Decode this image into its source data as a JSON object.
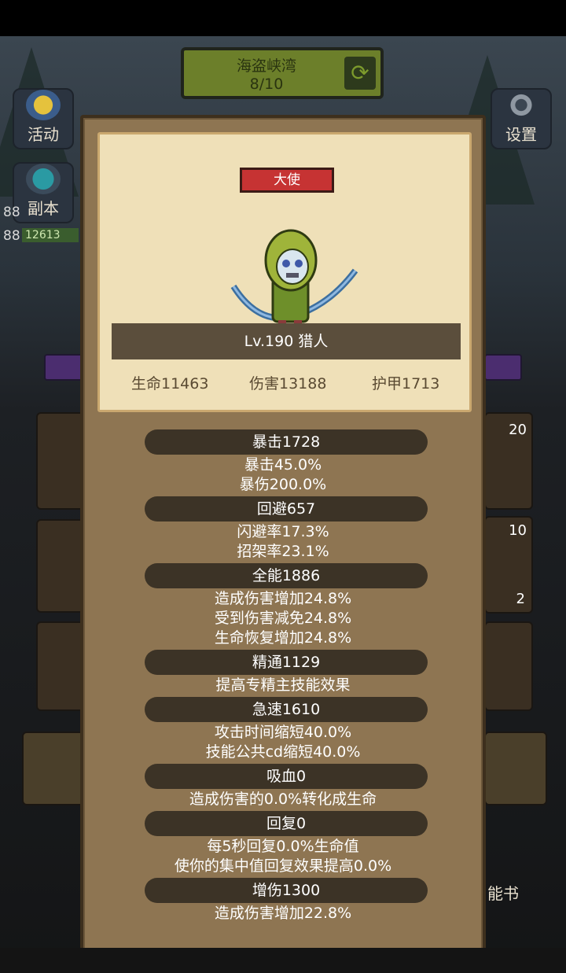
{
  "hud": {
    "stage_name": "海盗峡湾",
    "stage_progress": "8/10",
    "left_buttons": [
      "活动",
      "副本"
    ],
    "right_button": "设置",
    "counter_a": "88",
    "counter_b": "88",
    "hp_text": "12613",
    "counter_20": "20",
    "counter_10": "10",
    "counter_2": "2",
    "skill_book_label": "能书"
  },
  "hero": {
    "class_tag": "大使",
    "level_line": "Lv.190 猎人",
    "life": "生命11463",
    "damage": "伤害13188",
    "armor": "护甲1713"
  },
  "sections": [
    {
      "title": "暴击1728",
      "lines": [
        "暴击45.0%",
        "暴伤200.0%"
      ]
    },
    {
      "title": "回避657",
      "lines": [
        "闪避率17.3%",
        "招架率23.1%"
      ]
    },
    {
      "title": "全能1886",
      "lines": [
        "造成伤害增加24.8%",
        "受到伤害减免24.8%",
        "生命恢复增加24.8%"
      ]
    },
    {
      "title": "精通1129",
      "lines": [
        "提高专精主技能效果"
      ]
    },
    {
      "title": "急速1610",
      "lines": [
        "攻击时间缩短40.0%",
        "技能公共cd缩短40.0%"
      ]
    },
    {
      "title": "吸血0",
      "lines": [
        "造成伤害的0.0%转化成生命"
      ]
    },
    {
      "title": "回复0",
      "lines": [
        "每5秒回复0.0%生命值",
        "使你的集中值回复效果提高0.0%"
      ]
    },
    {
      "title": "增伤1300",
      "lines": [
        "造成伤害增加22.8%"
      ]
    }
  ]
}
